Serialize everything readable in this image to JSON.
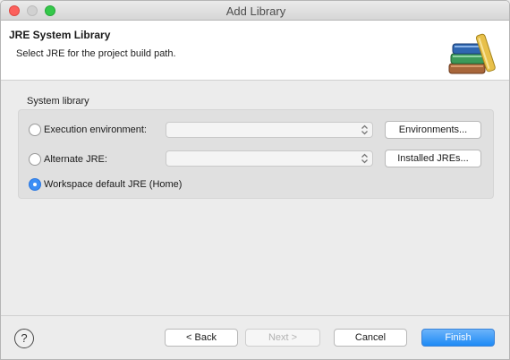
{
  "window": {
    "title": "Add Library"
  },
  "header": {
    "title": "JRE System Library",
    "description": "Select JRE for the project build path.",
    "icon": "library-books-icon"
  },
  "group": {
    "label": "System library",
    "options": [
      {
        "label": "Execution environment:",
        "selected": false,
        "combo_value": "",
        "button": "Environments..."
      },
      {
        "label": "Alternate JRE:",
        "selected": false,
        "combo_value": "",
        "button": "Installed JREs..."
      },
      {
        "label": "Workspace default JRE (Home)",
        "selected": true
      }
    ]
  },
  "footer": {
    "help_icon": "help-icon",
    "help_glyph": "?",
    "back_label": "< Back",
    "next_label": "Next >",
    "cancel_label": "Cancel",
    "finish_label": "Finish"
  },
  "colors": {
    "accent": "#3c8ef5",
    "close": "#fc605c",
    "maximize": "#34c84a"
  }
}
